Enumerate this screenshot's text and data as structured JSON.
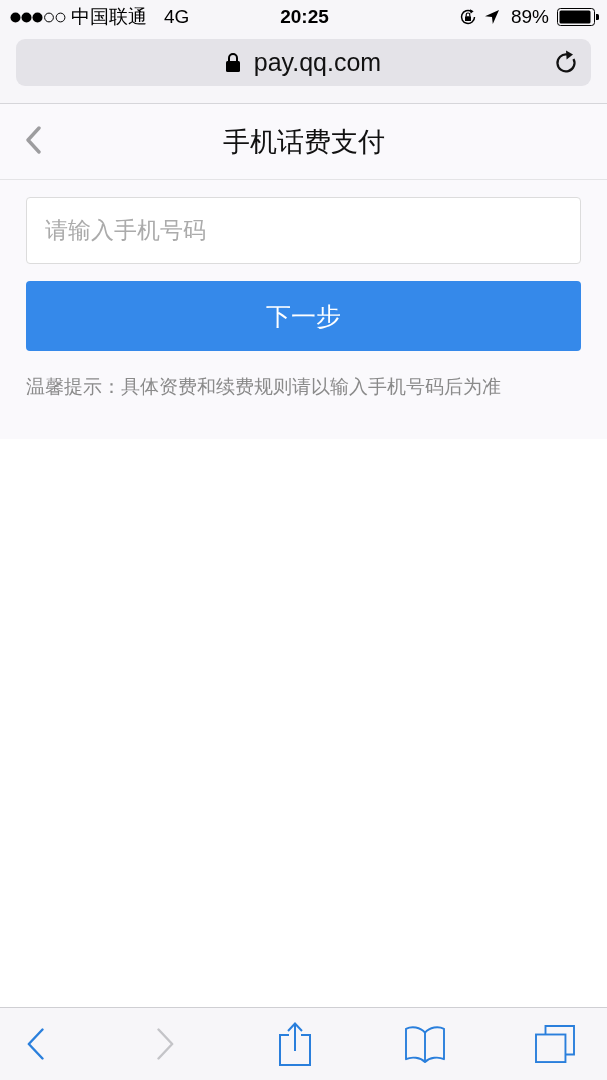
{
  "status_bar": {
    "carrier": "中国联通",
    "network": "4G",
    "time": "20:25",
    "battery": "89%"
  },
  "address_bar": {
    "url": "pay.qq.com",
    "secure": true
  },
  "header": {
    "title": "手机话费支付"
  },
  "form": {
    "phone_field": {
      "placeholder": "请输入手机号码"
    },
    "next_button": "下一步",
    "hint": "温馨提示：具体资费和续费规则请以输入手机号码后为准"
  },
  "toolbar": {
    "items": [
      {
        "kind": "back",
        "disabled": false
      },
      {
        "kind": "forward",
        "disabled": true
      },
      {
        "kind": "share",
        "disabled": false
      },
      {
        "kind": "bookmarks",
        "disabled": false
      },
      {
        "kind": "tabs",
        "disabled": false
      }
    ]
  }
}
